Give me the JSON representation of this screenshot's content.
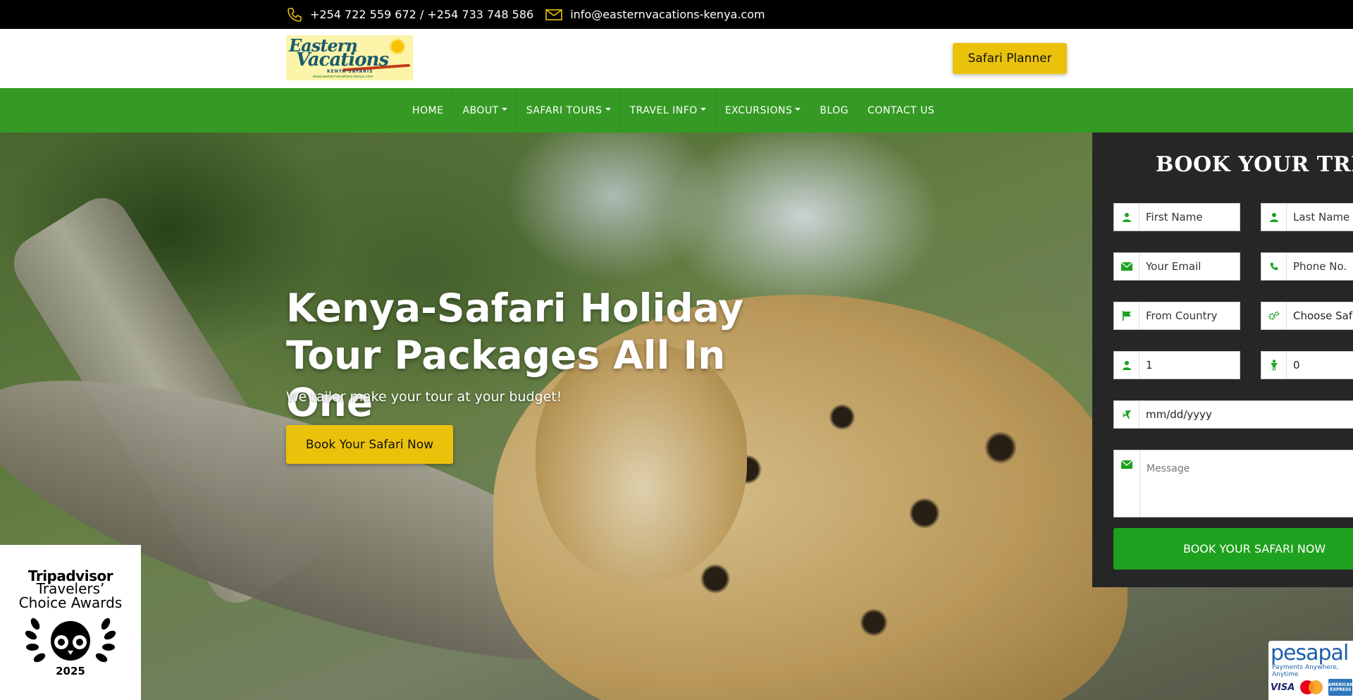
{
  "topbar": {
    "phone": "+254 722 559 672 / +254 733 748 586",
    "email": "info@easternvacations-kenya.com"
  },
  "header": {
    "logo_line1": "Eastern",
    "logo_line2": "Vacations",
    "logo_line3": "KENYA SAFARIS",
    "logo_url_text": "www.easternvacations-kenya.com",
    "planner_button": "Safari Planner"
  },
  "nav": {
    "items": [
      {
        "label": "HOME",
        "dropdown": false
      },
      {
        "label": "ABOUT",
        "dropdown": true
      },
      {
        "label": "SAFARI TOURS",
        "dropdown": true
      },
      {
        "label": "TRAVEL INFO",
        "dropdown": true
      },
      {
        "label": "EXCURSIONS",
        "dropdown": true
      },
      {
        "label": "BLOG",
        "dropdown": false
      },
      {
        "label": "CONTACT US",
        "dropdown": false
      }
    ]
  },
  "hero": {
    "title": "Kenya-Safari Holiday Tour Packages All In One",
    "subtitle": "We tailor make your tour at your budget!",
    "cta": "Book Your Safari Now"
  },
  "booking": {
    "title": "BOOK YOUR TRIP",
    "first_name_placeholder": "First Name",
    "last_name_placeholder": "Last Name",
    "email_placeholder": "Your Email",
    "phone_placeholder": "Phone No.",
    "country_placeholder": "From Country",
    "safari_select": "Choose Safari",
    "adults_value": "1",
    "children_value": "0",
    "date_placeholder": "mm/dd/yyyy",
    "message_placeholder": "Message",
    "submit_label": "BOOK YOUR SAFARI NOW"
  },
  "badges": {
    "tripadvisor_line1": "Tripadvisor",
    "tripadvisor_line2": "Travelers’",
    "tripadvisor_line3": "Choice Awards",
    "tripadvisor_year": "2025",
    "pesapal_name": "pesapal",
    "pesapal_tagline": "Payments Anywhere, Anytime",
    "visa": "VISA",
    "amex": "AMERICAN EXPRESS"
  },
  "colors": {
    "nav_green": "#359a24",
    "accent_yellow": "#eac20c",
    "submit_green": "#1ea11e",
    "form_bg": "#262626"
  },
  "icons": [
    "phone-icon",
    "mail-icon",
    "user-icon",
    "envelope-icon",
    "phone-handset-icon",
    "flag-icon",
    "cogs-icon",
    "child-icon",
    "plane-icon"
  ]
}
